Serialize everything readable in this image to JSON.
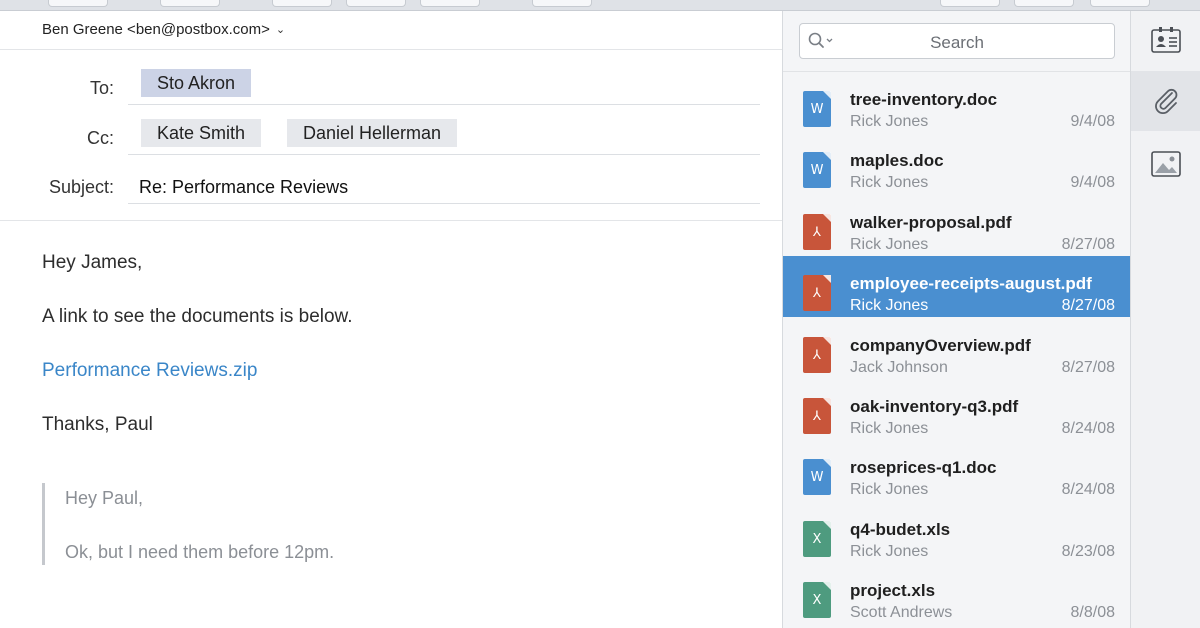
{
  "colors": {
    "accent": "#4a8fd0",
    "link": "#3a86c8",
    "doc_icon": "#4a8fd0",
    "pdf_icon": "#c8553a",
    "xls_icon": "#4e9b7f"
  },
  "compose": {
    "from": "Ben Greene <ben@postbox.com>",
    "to_label": "To:",
    "to": [
      "Sto Akron"
    ],
    "cc_label": "Cc:",
    "cc": [
      "Kate Smith",
      "Daniel Hellerman"
    ],
    "subject_label": "Subject:",
    "subject": "Re: Performance Reviews",
    "body": {
      "greeting": "Hey James,",
      "line1": "A link to see the documents is below.",
      "link": "Performance Reviews.zip",
      "signoff": "Thanks, Paul",
      "quote": [
        "Hey Paul,",
        "Ok, but I need them before 12pm."
      ]
    }
  },
  "attachments": {
    "search_placeholder": "Search",
    "files": [
      {
        "name": "tree-inventory.doc",
        "author": "Rick Jones",
        "date": "9/4/08",
        "type": "doc",
        "icon": "word-icon",
        "glyph": "W"
      },
      {
        "name": "maples.doc",
        "author": "Rick Jones",
        "date": "9/4/08",
        "type": "doc",
        "icon": "word-icon",
        "glyph": "W"
      },
      {
        "name": "walker-proposal.pdf",
        "author": "Rick Jones",
        "date": "8/27/08",
        "type": "pdf",
        "icon": "pdf-icon",
        "glyph": "⅄"
      },
      {
        "name": "employee-receipts-august.pdf",
        "author": "Rick Jones",
        "date": "8/27/08",
        "type": "pdf",
        "icon": "pdf-icon",
        "glyph": "⅄",
        "selected": true
      },
      {
        "name": "companyOverview.pdf",
        "author": "Jack Johnson",
        "date": "8/27/08",
        "type": "pdf",
        "icon": "pdf-icon",
        "glyph": "⅄"
      },
      {
        "name": "oak-inventory-q3.pdf",
        "author": "Rick Jones",
        "date": "8/24/08",
        "type": "pdf",
        "icon": "pdf-icon",
        "glyph": "⅄"
      },
      {
        "name": "roseprices-q1.doc",
        "author": "Rick Jones",
        "date": "8/24/08",
        "type": "doc",
        "icon": "word-icon",
        "glyph": "W"
      },
      {
        "name": "q4-budet.xls",
        "author": "Rick Jones",
        "date": "8/23/08",
        "type": "xls",
        "icon": "excel-icon",
        "glyph": "X"
      },
      {
        "name": "project.xls",
        "author": "Scott Andrews",
        "date": "8/8/08",
        "type": "xls",
        "icon": "excel-icon",
        "glyph": "X"
      }
    ]
  },
  "rail": {
    "buttons": [
      {
        "icon": "contact-card-icon",
        "active": false
      },
      {
        "icon": "paperclip-icon",
        "active": true
      },
      {
        "icon": "image-icon",
        "active": false
      }
    ]
  }
}
